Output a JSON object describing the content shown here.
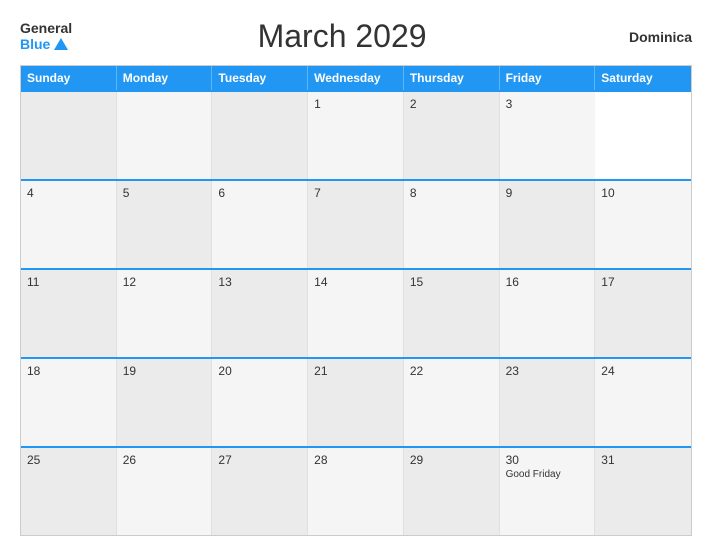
{
  "header": {
    "logo_general": "General",
    "logo_blue": "Blue",
    "title": "March 2029",
    "country": "Dominica"
  },
  "calendar": {
    "headers": [
      "Sunday",
      "Monday",
      "Tuesday",
      "Wednesday",
      "Thursday",
      "Friday",
      "Saturday"
    ],
    "rows": [
      [
        {
          "day": "",
          "event": ""
        },
        {
          "day": "",
          "event": ""
        },
        {
          "day": "",
          "event": ""
        },
        {
          "day": "1",
          "event": ""
        },
        {
          "day": "2",
          "event": ""
        },
        {
          "day": "3",
          "event": ""
        }
      ],
      [
        {
          "day": "4",
          "event": ""
        },
        {
          "day": "5",
          "event": ""
        },
        {
          "day": "6",
          "event": ""
        },
        {
          "day": "7",
          "event": ""
        },
        {
          "day": "8",
          "event": ""
        },
        {
          "day": "9",
          "event": ""
        },
        {
          "day": "10",
          "event": ""
        }
      ],
      [
        {
          "day": "11",
          "event": ""
        },
        {
          "day": "12",
          "event": ""
        },
        {
          "day": "13",
          "event": ""
        },
        {
          "day": "14",
          "event": ""
        },
        {
          "day": "15",
          "event": ""
        },
        {
          "day": "16",
          "event": ""
        },
        {
          "day": "17",
          "event": ""
        }
      ],
      [
        {
          "day": "18",
          "event": ""
        },
        {
          "day": "19",
          "event": ""
        },
        {
          "day": "20",
          "event": ""
        },
        {
          "day": "21",
          "event": ""
        },
        {
          "day": "22",
          "event": ""
        },
        {
          "day": "23",
          "event": ""
        },
        {
          "day": "24",
          "event": ""
        }
      ],
      [
        {
          "day": "25",
          "event": ""
        },
        {
          "day": "26",
          "event": ""
        },
        {
          "day": "27",
          "event": ""
        },
        {
          "day": "28",
          "event": ""
        },
        {
          "day": "29",
          "event": ""
        },
        {
          "day": "30",
          "event": "Good Friday"
        },
        {
          "day": "31",
          "event": ""
        }
      ]
    ]
  }
}
